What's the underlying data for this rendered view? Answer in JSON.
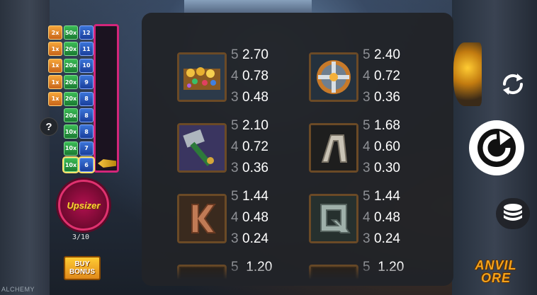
{
  "background": {
    "corner_text": "ALCHEMY"
  },
  "ladder": {
    "rows": [
      {
        "left": "2x",
        "mid": "50x",
        "right": "12",
        "active": false
      },
      {
        "left": "1x",
        "mid": "20x",
        "right": "11",
        "active": false
      },
      {
        "left": "1x",
        "mid": "20x",
        "right": "10",
        "active": false
      },
      {
        "left": "1x",
        "mid": "20x",
        "right": "9",
        "active": false
      },
      {
        "left": "1x",
        "mid": "20x",
        "right": "8",
        "active": false
      },
      {
        "left": "",
        "mid": "20x",
        "right": "8",
        "active": false
      },
      {
        "left": "",
        "mid": "10x",
        "right": "8",
        "active": false
      },
      {
        "left": "",
        "mid": "10x",
        "right": "7",
        "active": false
      },
      {
        "left": "",
        "mid": "10x",
        "right": "6",
        "active": true
      }
    ]
  },
  "help_label": "?",
  "upsizer": {
    "label": "Upsizer",
    "count": "3/10"
  },
  "buy_bonus": {
    "line1": "BUY",
    "line2": "BONUS"
  },
  "paytable": {
    "symbols": [
      {
        "name": "treasure-chest",
        "counts": [
          "5",
          "4",
          "3"
        ],
        "payouts": [
          "2.70",
          "0.78",
          "0.48"
        ]
      },
      {
        "name": "shield",
        "counts": [
          "5",
          "4",
          "3"
        ],
        "payouts": [
          "2.40",
          "0.72",
          "0.36"
        ]
      },
      {
        "name": "hammer",
        "counts": [
          "5",
          "4",
          "3"
        ],
        "payouts": [
          "2.10",
          "0.72",
          "0.36"
        ]
      },
      {
        "name": "rune-a",
        "counts": [
          "5",
          "4",
          "3"
        ],
        "payouts": [
          "1.68",
          "0.60",
          "0.30"
        ]
      },
      {
        "name": "rune-k",
        "counts": [
          "5",
          "4",
          "3"
        ],
        "payouts": [
          "1.44",
          "0.48",
          "0.24"
        ]
      },
      {
        "name": "rune-q",
        "counts": [
          "5",
          "4",
          "3"
        ],
        "payouts": [
          "1.44",
          "0.48",
          "0.24"
        ]
      }
    ],
    "partial_row": [
      {
        "count": "5",
        "payout": "1.20"
      },
      {
        "count": "5",
        "payout": "1.20"
      }
    ]
  },
  "logo": {
    "line1": "ANVIL",
    "line2": "ORE"
  }
}
